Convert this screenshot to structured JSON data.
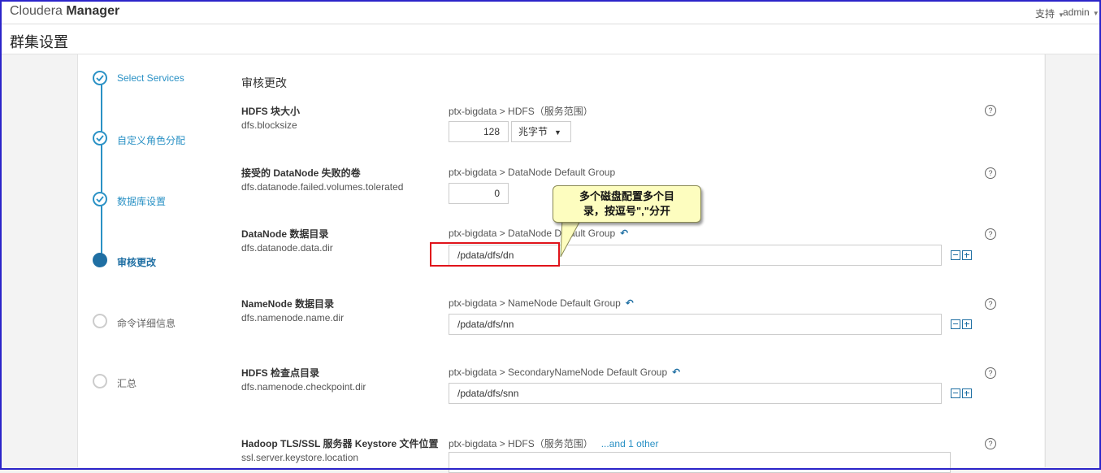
{
  "header": {
    "brand_light": "Cloudera",
    "brand_bold": "Manager",
    "support_label": "支持",
    "user_label": "admin"
  },
  "page": {
    "title": "群集设置"
  },
  "wizard": {
    "steps": [
      {
        "label": "Select Services",
        "state": "done"
      },
      {
        "label": "自定义角色分配",
        "state": "done"
      },
      {
        "label": "数据库设置",
        "state": "done"
      },
      {
        "label": "审核更改",
        "state": "current"
      },
      {
        "label": "命令详细信息",
        "state": "pending"
      },
      {
        "label": "汇总",
        "state": "pending"
      }
    ]
  },
  "main": {
    "section_title": "审核更改",
    "properties": [
      {
        "label": "HDFS 块大小",
        "key": "dfs.blocksize",
        "scope": "ptx-bigdata > HDFS（服务范围）",
        "value": "128",
        "unit": "兆字节"
      },
      {
        "label": "接受的 DataNode 失败的卷",
        "key": "dfs.datanode.failed.volumes.tolerated",
        "scope": "ptx-bigdata > DataNode Default Group",
        "value": "0"
      },
      {
        "label": "DataNode 数据目录",
        "key": "dfs.datanode.data.dir",
        "scope": "ptx-bigdata > DataNode Default Group",
        "value": "/pdata/dfs/dn"
      },
      {
        "label": "NameNode 数据目录",
        "key": "dfs.namenode.name.dir",
        "scope": "ptx-bigdata > NameNode Default Group",
        "value": "/pdata/dfs/nn"
      },
      {
        "label": "HDFS 检查点目录",
        "key": "dfs.namenode.checkpoint.dir",
        "scope": "ptx-bigdata > SecondaryNameNode Default Group",
        "value": "/pdata/dfs/snn"
      },
      {
        "label": "Hadoop TLS/SSL 服务器 Keystore 文件位置",
        "key": "ssl.server.keystore.location",
        "scope": "ptx-bigdata > HDFS（服务范围）",
        "other_link": "...and 1 other",
        "value": ""
      }
    ],
    "help_glyph": "?",
    "revert_glyph": "↶"
  },
  "annotation": {
    "callout_line1": "多个磁盘配置多个目",
    "callout_line2": "录，按逗号\",\"分开"
  },
  "colors": {
    "accent": "#2a91c5",
    "highlight": "#e0141b",
    "callout_bg": "#fdfdbf",
    "frame": "#2b24c9"
  }
}
